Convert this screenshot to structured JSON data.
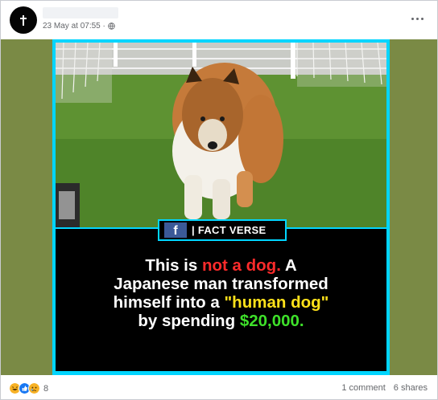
{
  "post": {
    "timestamp": "23 May at 07:55 ·",
    "privacy_icon": "globe-icon",
    "menu_icon": "more-dots-icon"
  },
  "media": {
    "badge_text": "| FACT VERSE",
    "badge_logo": "f",
    "caption": {
      "line1_a": "This is ",
      "line1_red": "not a dog.",
      "line1_b": " A",
      "line2": "Japanese man transformed",
      "line3_a": "himself into a ",
      "line3_yellow": "\"human dog\"",
      "line4_a": "by spending ",
      "line4_green": "$20,000."
    },
    "colors": {
      "frame": "#00d5ff",
      "red": "#ff2b2b",
      "yellow": "#ffe11a",
      "green": "#3ee12a"
    }
  },
  "footer": {
    "reaction_count": "8",
    "comments": "1 comment",
    "shares": "6 shares"
  }
}
